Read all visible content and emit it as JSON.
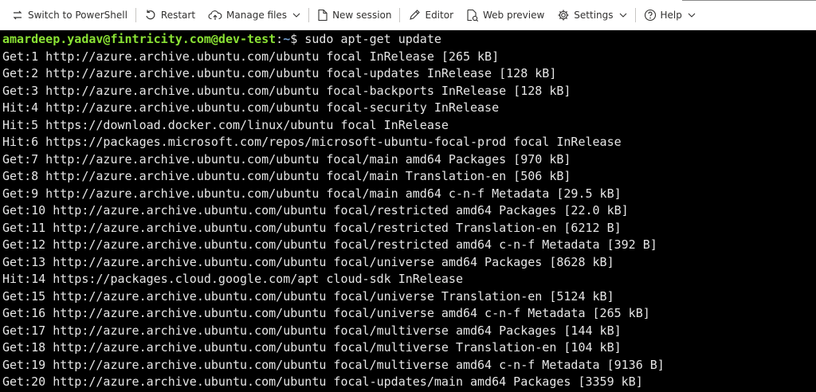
{
  "toolbar": {
    "switch_label": "Switch to PowerShell",
    "restart_label": "Restart",
    "manage_files_label": "Manage files",
    "new_session_label": "New session",
    "editor_label": "Editor",
    "web_preview_label": "Web preview",
    "settings_label": "Settings",
    "help_label": "Help"
  },
  "terminal": {
    "prompt_user": "amardeep.yadav@fintricity.com@dev-test",
    "prompt_sep": ":",
    "prompt_path": "~",
    "prompt_symbol": "$ ",
    "command": "sudo apt-get update",
    "lines": [
      "Get:1 http://azure.archive.ubuntu.com/ubuntu focal InRelease [265 kB]",
      "Get:2 http://azure.archive.ubuntu.com/ubuntu focal-updates InRelease [128 kB]",
      "Get:3 http://azure.archive.ubuntu.com/ubuntu focal-backports InRelease [128 kB]",
      "Hit:4 http://azure.archive.ubuntu.com/ubuntu focal-security InRelease",
      "Hit:5 https://download.docker.com/linux/ubuntu focal InRelease",
      "Hit:6 https://packages.microsoft.com/repos/microsoft-ubuntu-focal-prod focal InRelease",
      "Get:7 http://azure.archive.ubuntu.com/ubuntu focal/main amd64 Packages [970 kB]",
      "Get:8 http://azure.archive.ubuntu.com/ubuntu focal/main Translation-en [506 kB]",
      "Get:9 http://azure.archive.ubuntu.com/ubuntu focal/main amd64 c-n-f Metadata [29.5 kB]",
      "Get:10 http://azure.archive.ubuntu.com/ubuntu focal/restricted amd64 Packages [22.0 kB]",
      "Get:11 http://azure.archive.ubuntu.com/ubuntu focal/restricted Translation-en [6212 B]",
      "Get:12 http://azure.archive.ubuntu.com/ubuntu focal/restricted amd64 c-n-f Metadata [392 B]",
      "Get:13 http://azure.archive.ubuntu.com/ubuntu focal/universe amd64 Packages [8628 kB]",
      "Hit:14 https://packages.cloud.google.com/apt cloud-sdk InRelease",
      "Get:15 http://azure.archive.ubuntu.com/ubuntu focal/universe Translation-en [5124 kB]",
      "Get:16 http://azure.archive.ubuntu.com/ubuntu focal/universe amd64 c-n-f Metadata [265 kB]",
      "Get:17 http://azure.archive.ubuntu.com/ubuntu focal/multiverse amd64 Packages [144 kB]",
      "Get:18 http://azure.archive.ubuntu.com/ubuntu focal/multiverse Translation-en [104 kB]",
      "Get:19 http://azure.archive.ubuntu.com/ubuntu focal/multiverse amd64 c-n-f Metadata [9136 B]",
      "Get:20 http://azure.archive.ubuntu.com/ubuntu focal-updates/main amd64 Packages [3359 kB]"
    ]
  }
}
